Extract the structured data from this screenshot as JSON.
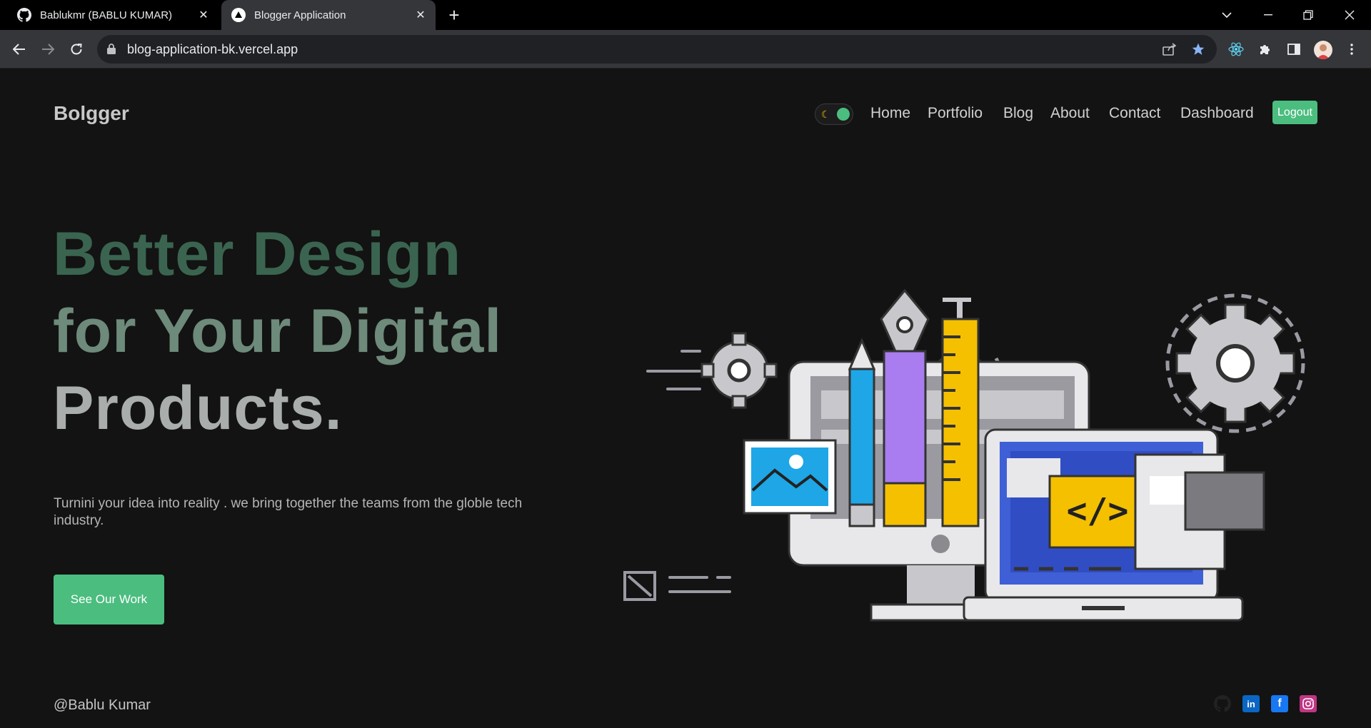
{
  "browser": {
    "tabs": [
      {
        "title": "Bablukmr (BABLU KUMAR)",
        "icon": "github-icon"
      },
      {
        "title": "Blogger Application",
        "icon": "vercel-icon"
      }
    ],
    "url": "blog-application-bk.vercel.app"
  },
  "site": {
    "brand": "Bolgger",
    "nav": [
      "Home",
      "Portfolio",
      "Blog",
      "About",
      "Contact",
      "Dashboard"
    ],
    "logout": "Logout",
    "hero": {
      "line1": "Better Design",
      "line2": "for Your Digital",
      "line3": "Products.",
      "subtitle": "Turnini your idea into reality . we bring together the teams from the globle tech industry.",
      "cta": "See Our Work"
    },
    "footer": {
      "credit": "@Bablu Kumar",
      "social": [
        "github-icon",
        "linkedin-icon",
        "facebook-icon",
        "instagram-icon"
      ]
    }
  },
  "colors": {
    "accent": "#4bbd7f",
    "background": "#131313",
    "linkedin": "#0a66c2",
    "facebook": "#1877f2",
    "instagram": "#c13584"
  }
}
